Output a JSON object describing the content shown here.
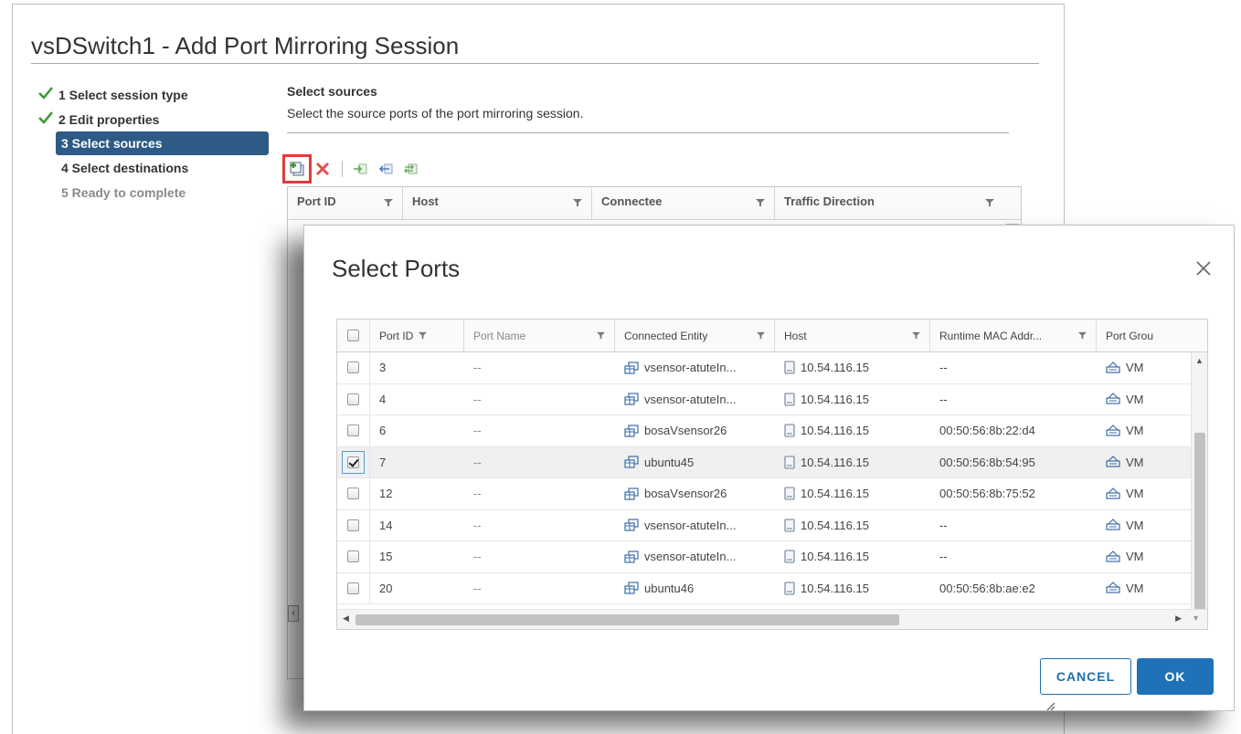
{
  "wizard": {
    "title": "vsDSwitch1 - Add Port Mirroring Session",
    "steps": [
      {
        "label": "1 Select session type",
        "state": "done"
      },
      {
        "label": "2 Edit properties",
        "state": "done"
      },
      {
        "label": "3 Select sources",
        "state": "active"
      },
      {
        "label": "4 Select destinations",
        "state": "pending"
      },
      {
        "label": "5 Ready to complete",
        "state": "disabled"
      }
    ],
    "section_title": "Select sources",
    "section_desc": "Select the source ports of the port mirroring session.",
    "grid_columns": [
      "Port ID",
      "Host",
      "Connectee",
      "Traffic Direction"
    ]
  },
  "modal": {
    "title": "Select Ports",
    "columns": [
      "Port ID",
      "Port Name",
      "Connected Entity",
      "Host",
      "Runtime MAC Addr...",
      "Port Grou"
    ],
    "rows": [
      {
        "id": "3",
        "name": "--",
        "entity": "vsensor-atuteIn...",
        "host": "10.54.116.15",
        "mac": "--",
        "group": "VM",
        "checked": false
      },
      {
        "id": "4",
        "name": "--",
        "entity": "vsensor-atuteIn...",
        "host": "10.54.116.15",
        "mac": "--",
        "group": "VM",
        "checked": false
      },
      {
        "id": "6",
        "name": "--",
        "entity": "bosaVsensor26",
        "host": "10.54.116.15",
        "mac": "00:50:56:8b:22:d4",
        "group": "VM",
        "checked": false
      },
      {
        "id": "7",
        "name": "--",
        "entity": "ubuntu45",
        "host": "10.54.116.15",
        "mac": "00:50:56:8b:54:95",
        "group": "VM",
        "checked": true
      },
      {
        "id": "12",
        "name": "--",
        "entity": "bosaVsensor26",
        "host": "10.54.116.15",
        "mac": "00:50:56:8b:75:52",
        "group": "VM",
        "checked": false
      },
      {
        "id": "14",
        "name": "--",
        "entity": "vsensor-atuteIn...",
        "host": "10.54.116.15",
        "mac": "--",
        "group": "VM",
        "checked": false
      },
      {
        "id": "15",
        "name": "--",
        "entity": "vsensor-atuteIn...",
        "host": "10.54.116.15",
        "mac": "--",
        "group": "VM",
        "checked": false
      },
      {
        "id": "20",
        "name": "--",
        "entity": "ubuntu46",
        "host": "10.54.116.15",
        "mac": "00:50:56:8b:ae:e2",
        "group": "VM",
        "checked": false
      }
    ],
    "cancel_label": "CANCEL",
    "ok_label": "OK"
  },
  "colors": {
    "active_step": "#2e5a86",
    "check_green": "#3a9a2e",
    "primary": "#1f72b8",
    "highlight_red": "#e23b3b"
  },
  "icons": {
    "add": "add-ports-icon",
    "remove": "remove-icon",
    "close": "close-icon",
    "vm": "vm-icon",
    "host": "host-icon",
    "portgroup": "portgroup-icon"
  }
}
